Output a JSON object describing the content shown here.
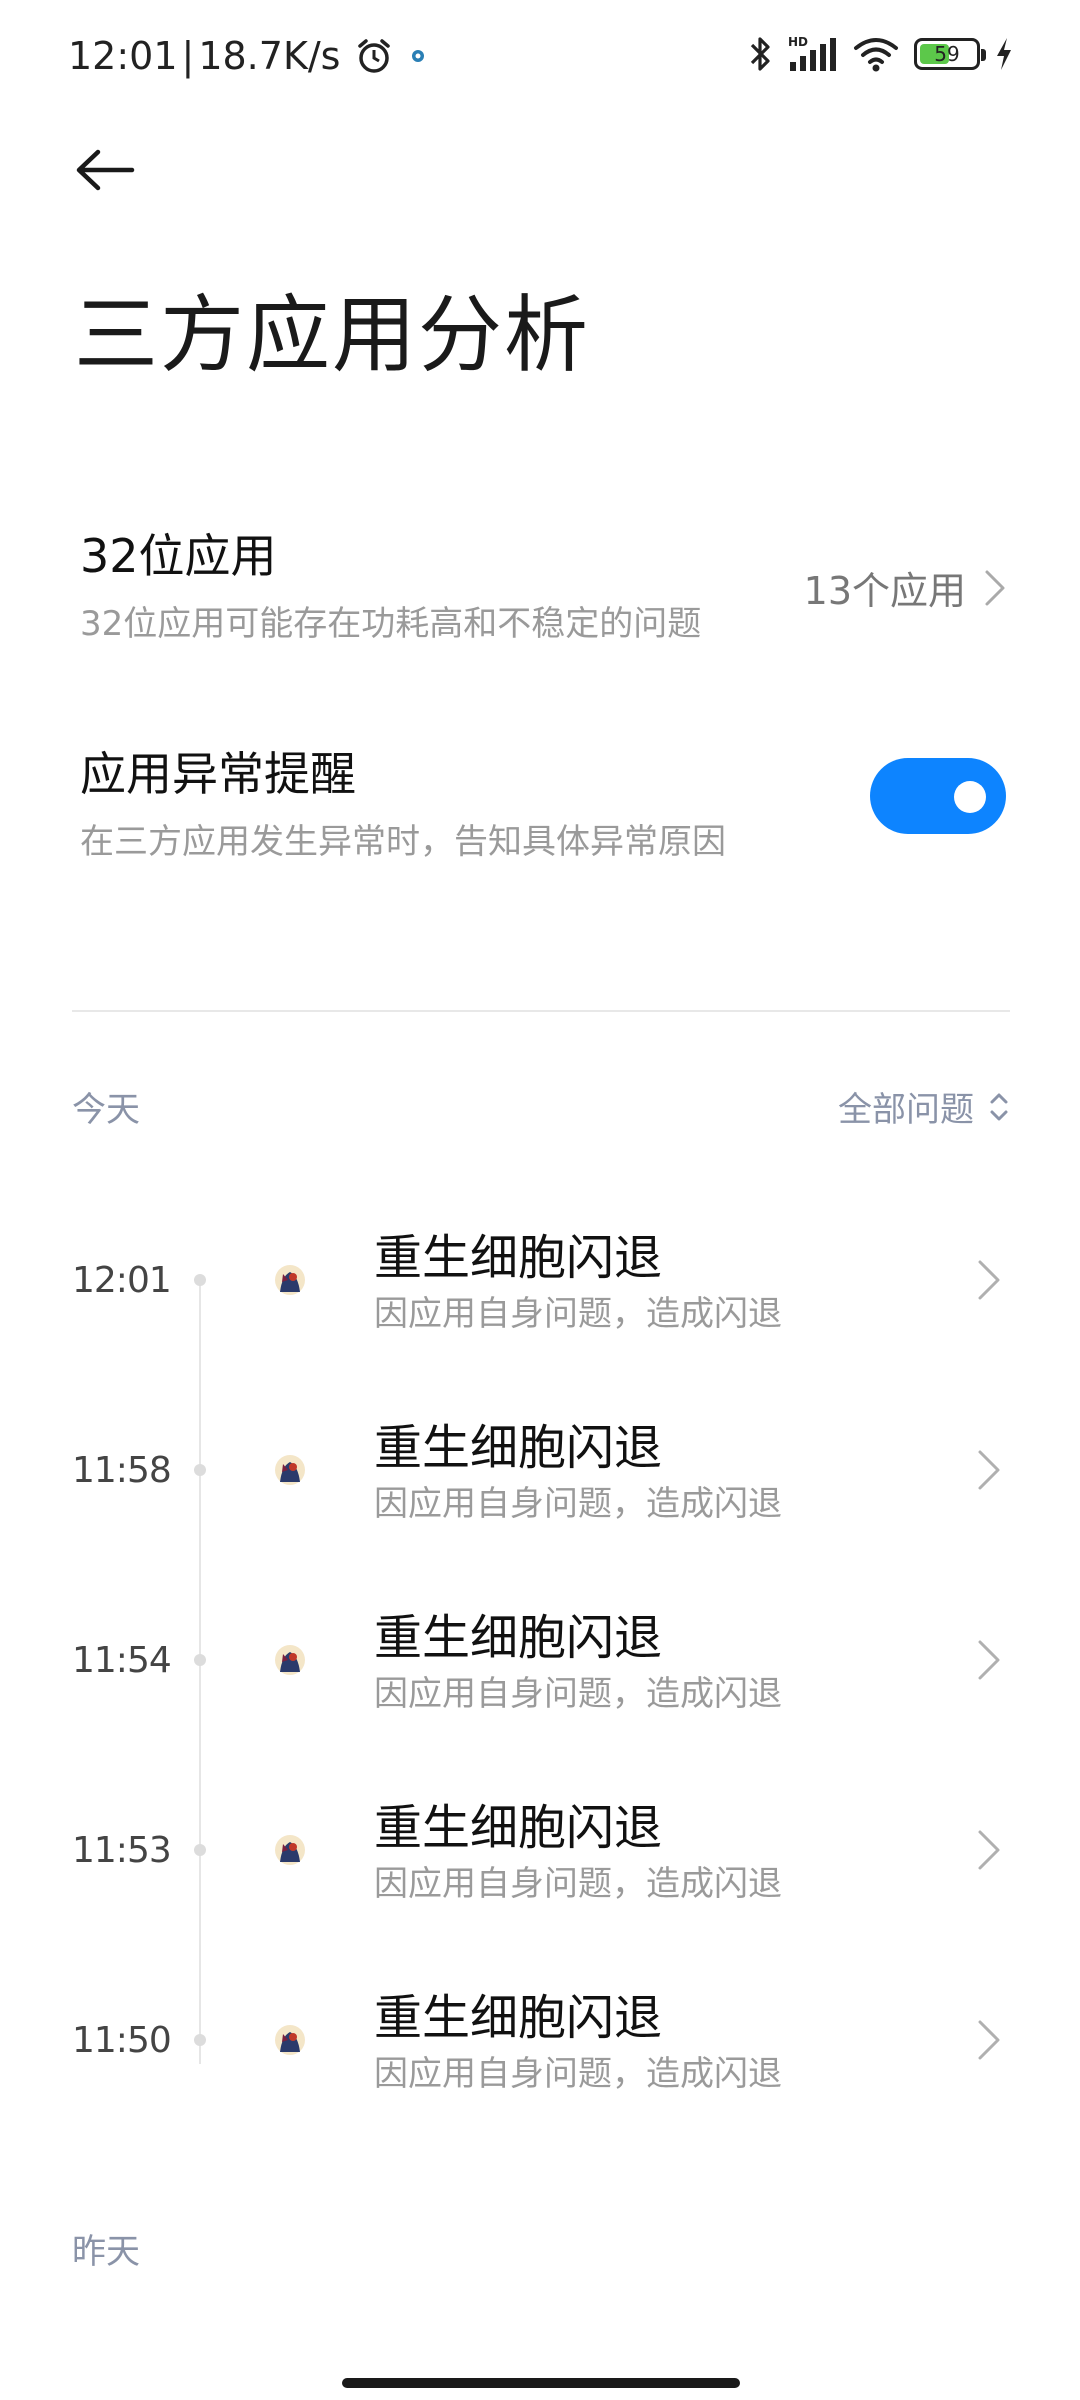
{
  "status_bar": {
    "time": "12:01",
    "net_speed": "18.7K/s",
    "battery": "59",
    "battery_level": 0.59,
    "icons": [
      "alarm-icon",
      "location-dot-icon",
      "bluetooth-icon",
      "hd-signal-icon",
      "wifi-icon",
      "battery-icon",
      "charging-icon"
    ]
  },
  "header": {
    "title": "三方应用分析"
  },
  "settings": {
    "apps32": {
      "title": "32位应用",
      "subtitle": "32位应用可能存在功耗高和不稳定的问题",
      "value": "13个应用"
    },
    "abnormal_alert": {
      "title": "应用异常提醒",
      "subtitle": "在三方应用发生异常时，告知具体异常原因",
      "enabled": true
    }
  },
  "today": {
    "label": "今天",
    "filter_label": "全部问题",
    "items": [
      {
        "time": "12:01",
        "title": "重生细胞闪退",
        "subtitle": "因应用自身问题，造成闪退"
      },
      {
        "time": "11:58",
        "title": "重生细胞闪退",
        "subtitle": "因应用自身问题，造成闪退"
      },
      {
        "time": "11:54",
        "title": "重生细胞闪退",
        "subtitle": "因应用自身问题，造成闪退"
      },
      {
        "time": "11:53",
        "title": "重生细胞闪退",
        "subtitle": "因应用自身问题，造成闪退"
      },
      {
        "time": "11:50",
        "title": "重生细胞闪退",
        "subtitle": "因应用自身问题，造成闪退"
      }
    ]
  },
  "yesterday": {
    "label": "昨天"
  },
  "colors": {
    "accent": "#0d84ff",
    "secondary_text": "#9a9a9a",
    "section_text": "#8a93a8",
    "battery_green": "#5cc84a"
  }
}
